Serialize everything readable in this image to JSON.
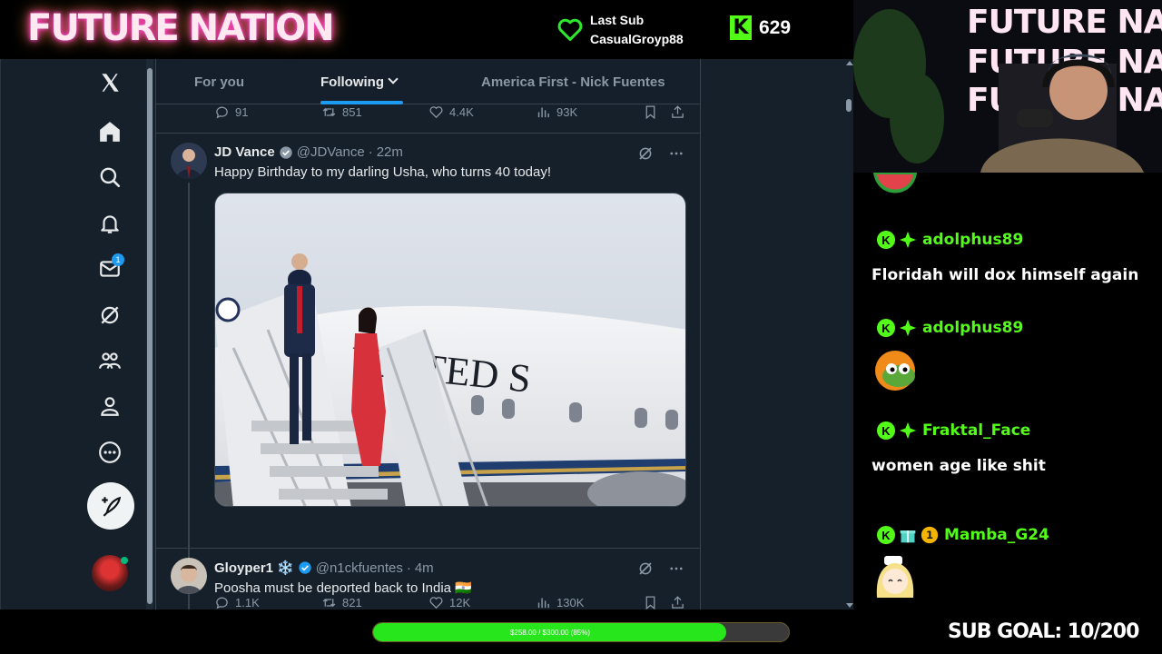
{
  "overlay": {
    "logo": "FUTURE NATION",
    "last_sub_label": "Last Sub",
    "last_sub_name": "CasualGroyp88",
    "viewer_count": "629",
    "kick_badge": "K",
    "goal_text": "$258.00 / $300.00 (85%)",
    "goal_fraction": 0.85,
    "sub_goal": "SUB GOAL: 10/200",
    "colors": {
      "accent_green": "#53fc18",
      "x_blue": "#1d9bf0"
    }
  },
  "sidebar": {
    "items": [
      "x-logo",
      "home-icon",
      "search-icon",
      "notifications-icon",
      "messages-icon",
      "grok-icon",
      "communities-icon",
      "profile-icon",
      "more-icon"
    ],
    "messages_badge": "1"
  },
  "tabs": [
    {
      "label": "For you"
    },
    {
      "label": "Following"
    },
    {
      "label": "America First - Nick Fuentes"
    }
  ],
  "prev_tweet_actions": {
    "replies": "91",
    "reposts": "851",
    "likes": "4.4K",
    "views": "93K"
  },
  "tweet1": {
    "name": "JD Vance",
    "handle": "@JDVance",
    "time": "22m",
    "text": "Happy Birthday to my darling Usha, who turns 40 today!",
    "photo_plane_text": "UNITED S",
    "actions": {
      "replies": "1.1K",
      "reposts": "821",
      "likes": "12K",
      "views": "130K"
    }
  },
  "tweet2": {
    "name": "Gloyper1",
    "snow": "❄️",
    "handle": "@n1ckfuentes",
    "time": "4m",
    "text": "Poosha must be deported back to India 🇮🇳"
  },
  "chat": {
    "messages": [
      {
        "user": "adolphus89",
        "text": "Floridah will dox himself again"
      },
      {
        "user": "adolphus89",
        "text": ""
      },
      {
        "user": "Fraktal_Face",
        "text": "women age like shit"
      },
      {
        "user": "Mamba_G24",
        "text": ""
      }
    ]
  },
  "webcam": {
    "sign_lines": [
      "FUTURE NATION",
      "FUTURE NATION",
      "FUTURE NATION"
    ]
  }
}
